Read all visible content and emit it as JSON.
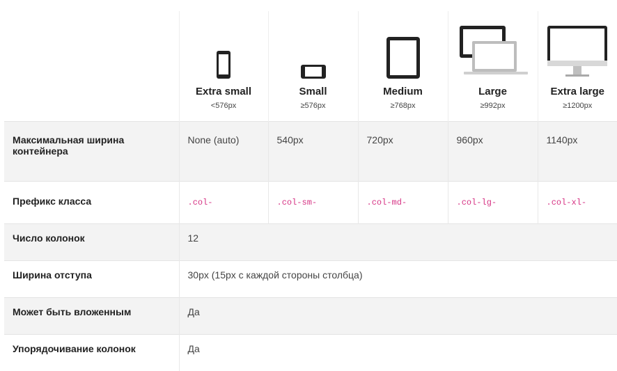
{
  "header": {
    "devices": [
      {
        "icon": "phone-portrait-icon",
        "title": "Extra small",
        "size": "<576px"
      },
      {
        "icon": "phone-landscape-icon",
        "title": "Small",
        "size": "≥576px"
      },
      {
        "icon": "tablet-icon",
        "title": "Medium",
        "size": "≥768px"
      },
      {
        "icon": "laptop-icon",
        "title": "Large",
        "size": "≥992px"
      },
      {
        "icon": "desktop-monitor-icon",
        "title": "Extra large",
        "size": "≥1200px"
      }
    ]
  },
  "rows": {
    "max_width": {
      "label": "Максимальная ширина контейнера",
      "values": [
        "None (auto)",
        "540px",
        "720px",
        "960px",
        "1140px"
      ]
    },
    "class_prefix": {
      "label": "Префикс класса",
      "values": [
        ".col-",
        ".col-sm-",
        ".col-md-",
        ".col-lg-",
        ".col-xl-"
      ]
    },
    "columns": {
      "label": "Число колонок",
      "value": "12"
    },
    "gutter": {
      "label": "Ширина отступа",
      "value": "30px (15px с каждой стороны столбца)"
    },
    "nestable": {
      "label": "Может быть вложенным",
      "value": "Да"
    },
    "ordering": {
      "label": "Упорядочивание колонок",
      "value": "Да"
    }
  },
  "colors": {
    "prefix_text": "#d63384",
    "shaded_row": "#f3f3f3"
  }
}
